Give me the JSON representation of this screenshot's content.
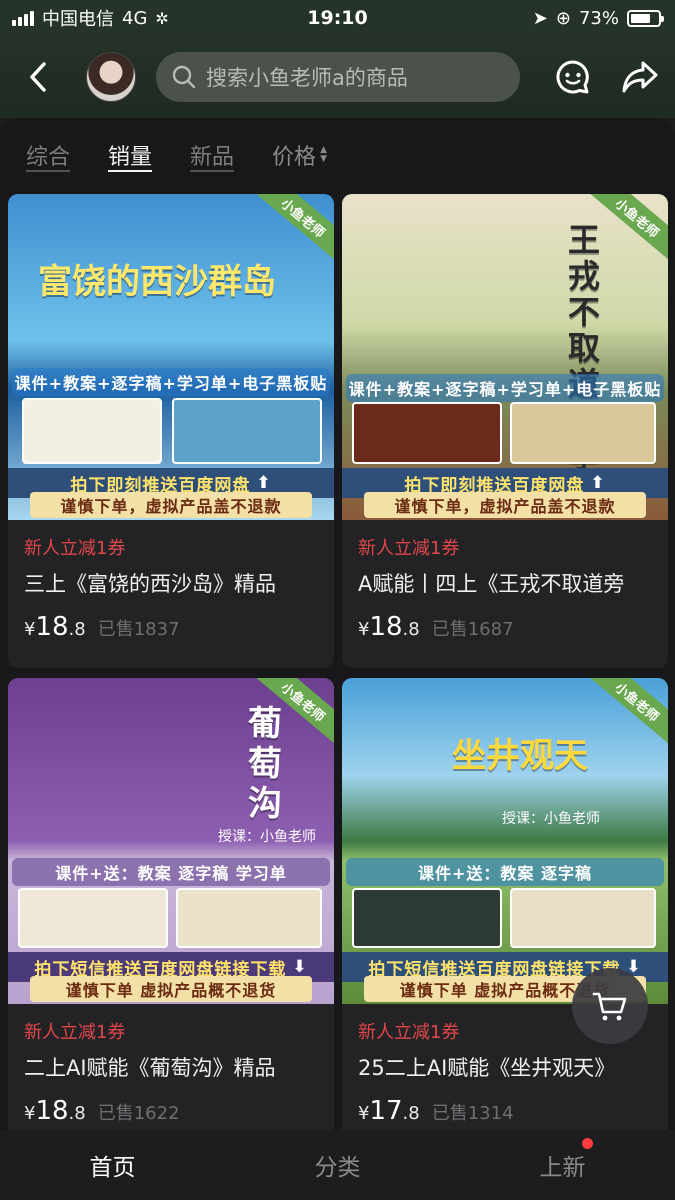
{
  "status_bar": {
    "carrier": "中国电信",
    "network": "4G",
    "time": "19:10",
    "battery": "73%",
    "battery_level": 0.73
  },
  "header": {
    "search_placeholder": "搜索小鱼老师a的商品",
    "icons": [
      "back-arrow-icon",
      "customer-service-icon",
      "share-icon"
    ]
  },
  "sort_tabs": [
    {
      "label": "综合",
      "active": false
    },
    {
      "label": "销量",
      "active": true
    },
    {
      "label": "新品",
      "active": false
    },
    {
      "label": "价格",
      "active": false
    }
  ],
  "products": [
    {
      "image": {
        "title": "富饶的西沙群岛",
        "brand": "小鱼老师",
        "bundle": "课件+教案+逐字稿+学习单+电子黑板贴",
        "push": "拍下即刻推送百度网盘",
        "warning": "谨慎下单，虚拟产品盖不退款",
        "bg_top": "#3f8fd0",
        "bg_bottom": "#a9d7ef"
      },
      "coupon": "新人立减1券",
      "name": "三上《富饶的西沙岛》精品",
      "price_yen": "¥",
      "price_int": "18",
      "price_dec": ".8",
      "sold": "已售1837"
    },
    {
      "image": {
        "title": "王戎不取道旁李",
        "brand": "小鱼老师",
        "bundle": "课件+教案+逐字稿+学习单+电子黑板贴",
        "push": "拍下即刻推送百度网盘",
        "warning": "谨慎下单，虚拟产品盖不退款",
        "bg_top": "#e8e2c9",
        "bg_bottom": "#8a5a3a"
      },
      "coupon": "新人立减1券",
      "name": "A赋能丨四上《王戎不取道旁",
      "price_yen": "¥",
      "price_int": "18",
      "price_dec": ".8",
      "sold": "已售1687"
    },
    {
      "image": {
        "title": "葡萄沟",
        "brand": "小鱼老师",
        "byline": "授课：小鱼老师",
        "bundle": "课件+送：教案 逐字稿 学习单",
        "push": "拍下短信推送百度网盘链接下载",
        "warning": "谨慎下单 虚拟产品概不退货",
        "bg_top": "#6d3f8f",
        "bg_bottom": "#b9a3cf"
      },
      "coupon": "新人立减1券",
      "name": "二上AI赋能《葡萄沟》精品",
      "price_yen": "¥",
      "price_int": "18",
      "price_dec": ".8",
      "sold": "已售1622"
    },
    {
      "image": {
        "title": "坐井观天",
        "brand": "小鱼老师",
        "byline": "授课：小鱼老师",
        "bundle": "课件+送：教案 逐字稿",
        "push": "拍下短信推送百度网盘链接下载",
        "warning": "谨慎下单 虚拟产品概不退货",
        "bg_top": "#4aa0d8",
        "bg_bottom": "#5c8a3a"
      },
      "coupon": "新人立减1券",
      "name": "25二上AI赋能《坐井观天》",
      "price_yen": "¥",
      "price_int": "17",
      "price_dec": ".8",
      "sold": "已售1314"
    }
  ],
  "cart_button": {
    "icon": "cart-icon"
  },
  "bottom_nav": [
    {
      "label": "首页",
      "active": true
    },
    {
      "label": "分类",
      "active": false
    },
    {
      "label": "上新",
      "active": false,
      "badge_dot": true
    }
  ]
}
